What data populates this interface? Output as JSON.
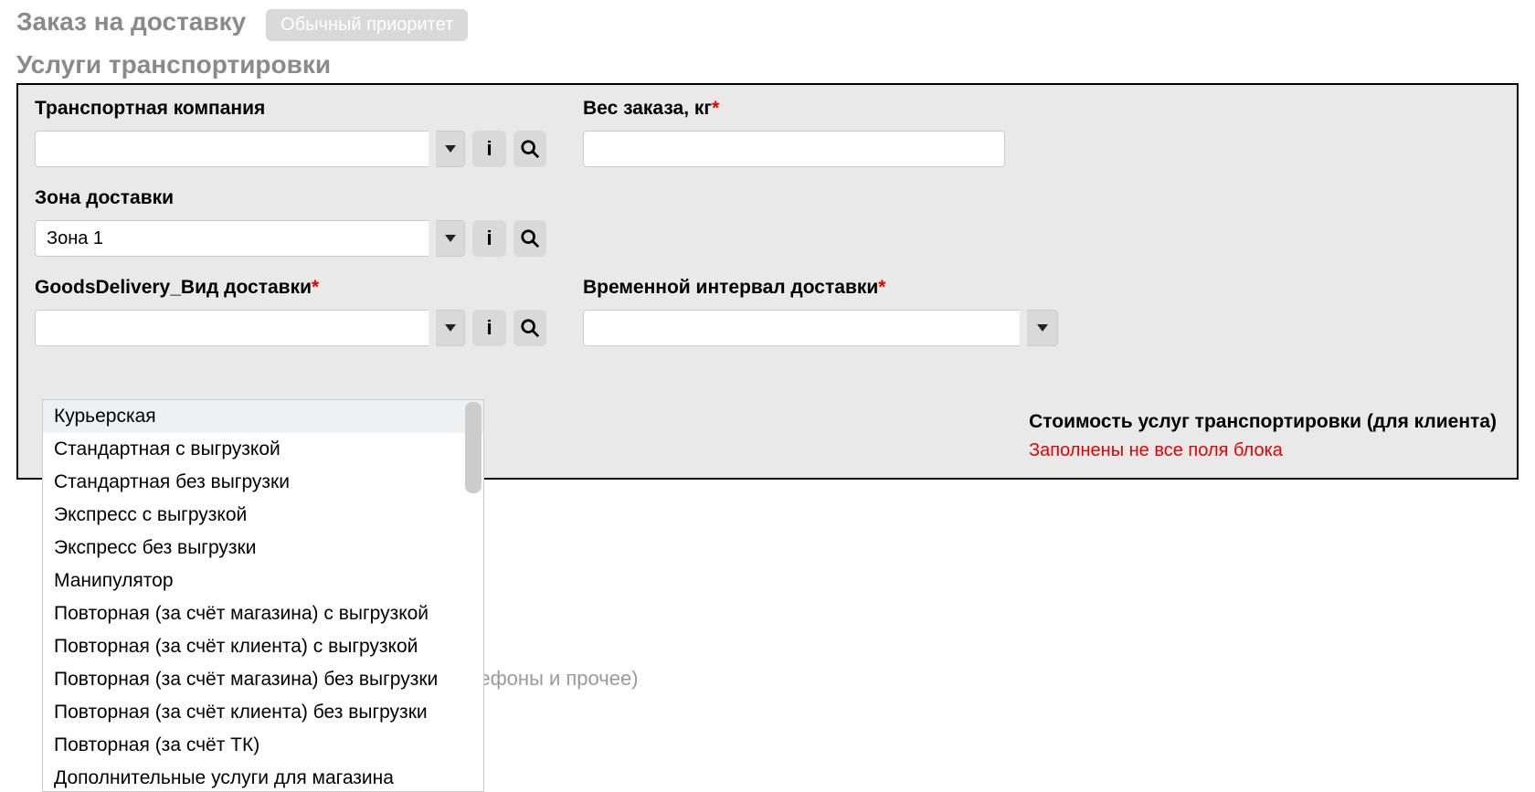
{
  "header": {
    "breadcrumb": "Заказ на доставку",
    "priority_button": "Обычный приоритет"
  },
  "section_title": "Услуги транспортировки",
  "fields": {
    "transport_company": {
      "label": "Транспортная компания",
      "value": ""
    },
    "order_weight": {
      "label": "Вес заказа, кг",
      "required": true,
      "value": ""
    },
    "delivery_zone": {
      "label": "Зона доставки",
      "value": "Зона 1"
    },
    "delivery_type": {
      "label": "GoodsDelivery_Вид доставки",
      "required": true,
      "value": ""
    },
    "time_interval": {
      "label": "Временной интервал доставки",
      "required": true,
      "value": ""
    }
  },
  "dropdown_options": [
    "Курьерская",
    "Стандартная с выгрузкой",
    "Стандартная без выгрузки",
    "Экспресс с выгрузкой",
    "Экспресс без выгрузки",
    "Манипулятор",
    "Повторная (за счёт магазина) с выгрузкой",
    "Повторная (за счёт клиента) с выгрузкой",
    "Повторная (за счёт магазина) без выгрузки",
    "Повторная (за счёт клиента) без выгрузки",
    "Повторная (за счёт ТК)",
    "Дополнительные услуги для магазина"
  ],
  "cost": {
    "title": "Стоимость услуг транспортировки (для клиента)",
    "error": "Заполнены не все поля блока"
  },
  "bg_placeholder": "елефоны и прочее)"
}
